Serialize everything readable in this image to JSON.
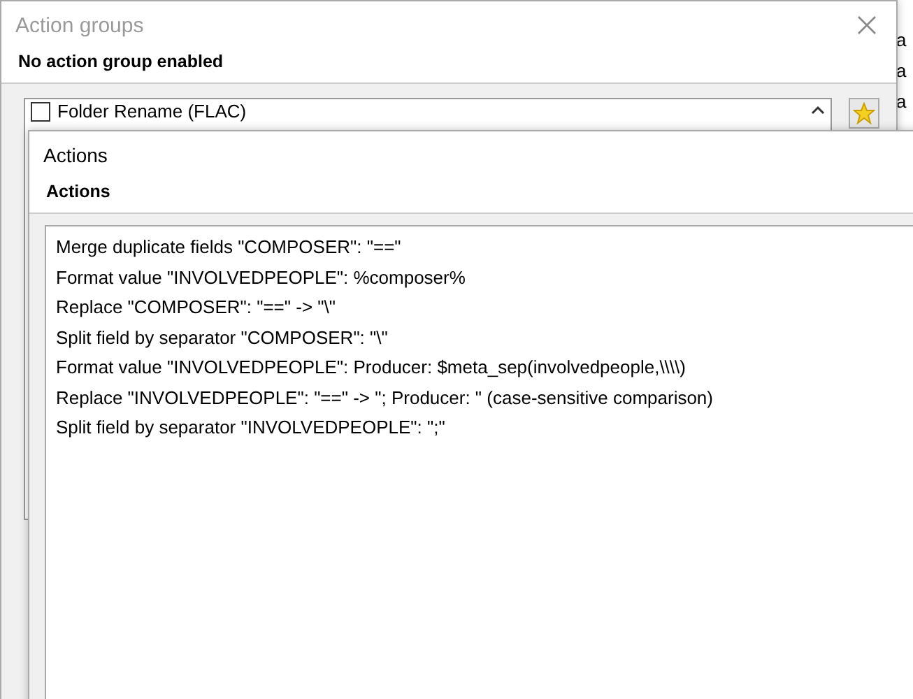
{
  "background_rows": [
    "a",
    "a",
    "a"
  ],
  "action_groups_window": {
    "title": "Action groups",
    "heading": "No action group enabled",
    "groups": [
      {
        "label": "Folder Rename (FLAC)",
        "checked": false
      }
    ]
  },
  "actions_window": {
    "title": "Actions",
    "heading": "Actions",
    "actions": [
      "Merge duplicate fields \"COMPOSER\": \"==\"",
      "Format value \"INVOLVEDPEOPLE\": %composer%",
      "Replace \"COMPOSER\": \"==\" -> \"\\\"",
      "Split field by separator \"COMPOSER\": \"\\\"",
      "Format value \"INVOLVEDPEOPLE\": Producer: $meta_sep(involvedpeople,\\\\\\\\)",
      "Replace \"INVOLVEDPEOPLE\": \"==\" -> \"; Producer: \" (case-sensitive comparison)",
      "Split field by separator \"INVOLVEDPEOPLE\": \";\""
    ]
  }
}
